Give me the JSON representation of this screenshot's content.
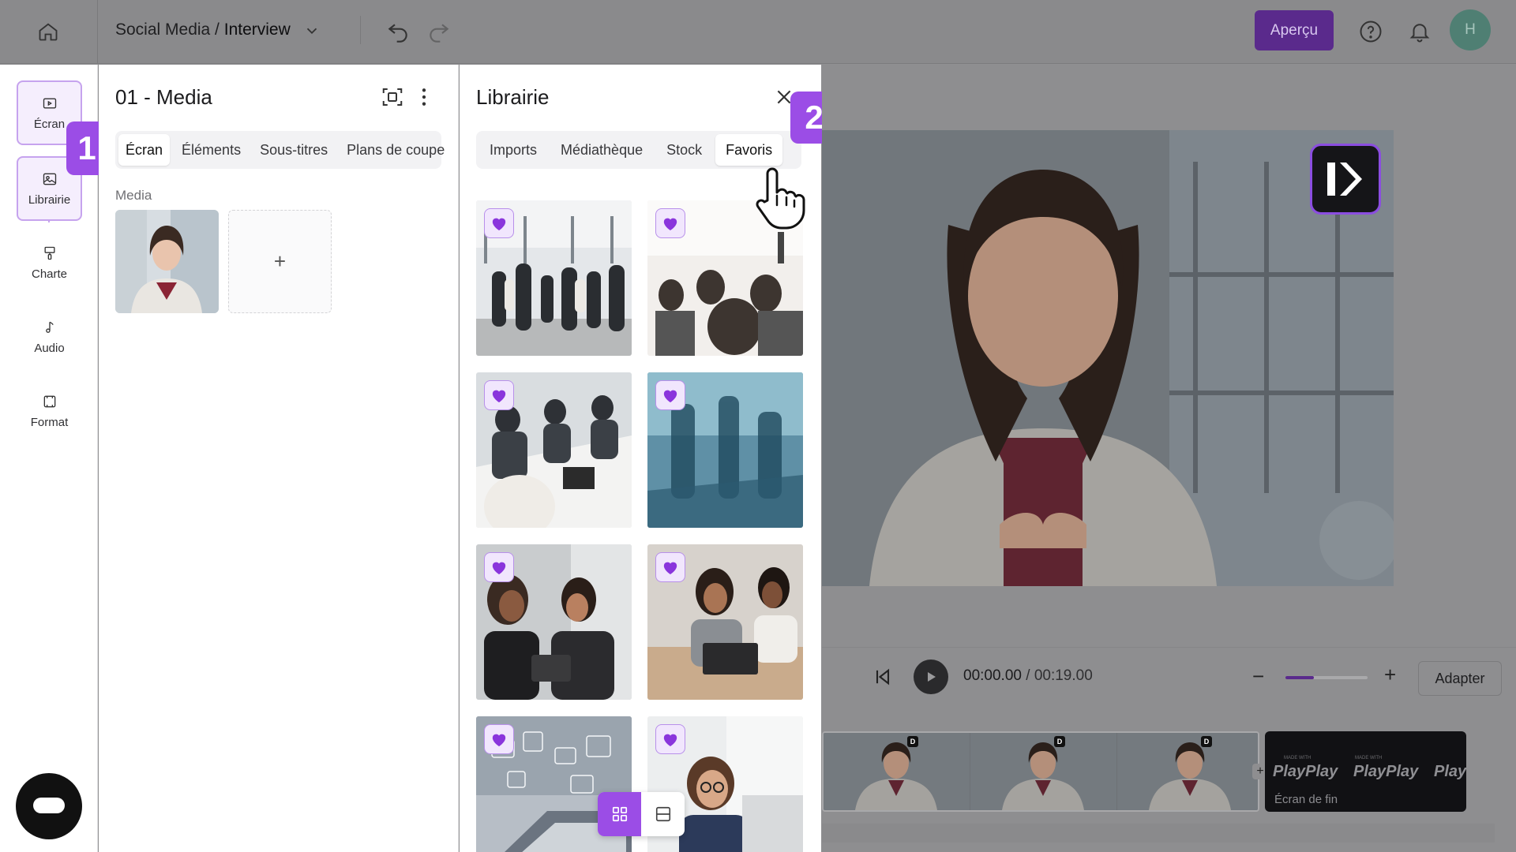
{
  "topbar": {
    "breadcrumb_parent": "Social Media / ",
    "breadcrumb_current": "Interview",
    "apercu_label": "Aperçu",
    "avatar_initial": "H"
  },
  "rail": {
    "items": [
      {
        "label": "Écran",
        "icon": "screen-icon"
      },
      {
        "label": "Librairie",
        "icon": "library-icon"
      },
      {
        "label": "Charte",
        "icon": "brush-icon"
      },
      {
        "label": "Audio",
        "icon": "music-note-icon"
      },
      {
        "label": "Format",
        "icon": "format-icon"
      }
    ],
    "badge_step": "1"
  },
  "media_panel": {
    "title": "01 - Media",
    "tabs": [
      "Écran",
      "Éléments",
      "Sous-titres",
      "Plans de coupe"
    ],
    "active_tab": "Écran",
    "section_label": "Media",
    "add_symbol": "+"
  },
  "library": {
    "title": "Librairie",
    "tabs": [
      "Imports",
      "Médiathèque",
      "Stock",
      "Favoris"
    ],
    "active_tab": "Favoris",
    "badge_step": "2",
    "favorites": [
      {
        "scene": "crowd-hall",
        "favorited": true
      },
      {
        "scene": "conference-audience",
        "favorited": true
      },
      {
        "scene": "meeting-table",
        "favorited": true
      },
      {
        "scene": "blue-office-blur",
        "favorited": true
      },
      {
        "scene": "women-tablet",
        "favorited": true
      },
      {
        "scene": "women-laptop",
        "favorited": true
      },
      {
        "scene": "tech-laptop",
        "favorited": true
      },
      {
        "scene": "woman-glasses-laptop",
        "favorited": true
      }
    ]
  },
  "player": {
    "current_time": "00:00.00",
    "separator": " / ",
    "total_time": "00:19.00",
    "zoom_level": 0.35,
    "adapter_label": "Adapter"
  },
  "timeline": {
    "end_card_label": "Écran de fin",
    "end_card_brand": "PlayPlay",
    "end_card_tagline": "MADE WITH"
  },
  "colors": {
    "accent": "#9b4de6",
    "apercu_bg": "#5a2a8c",
    "heart": "#8a35dc"
  }
}
